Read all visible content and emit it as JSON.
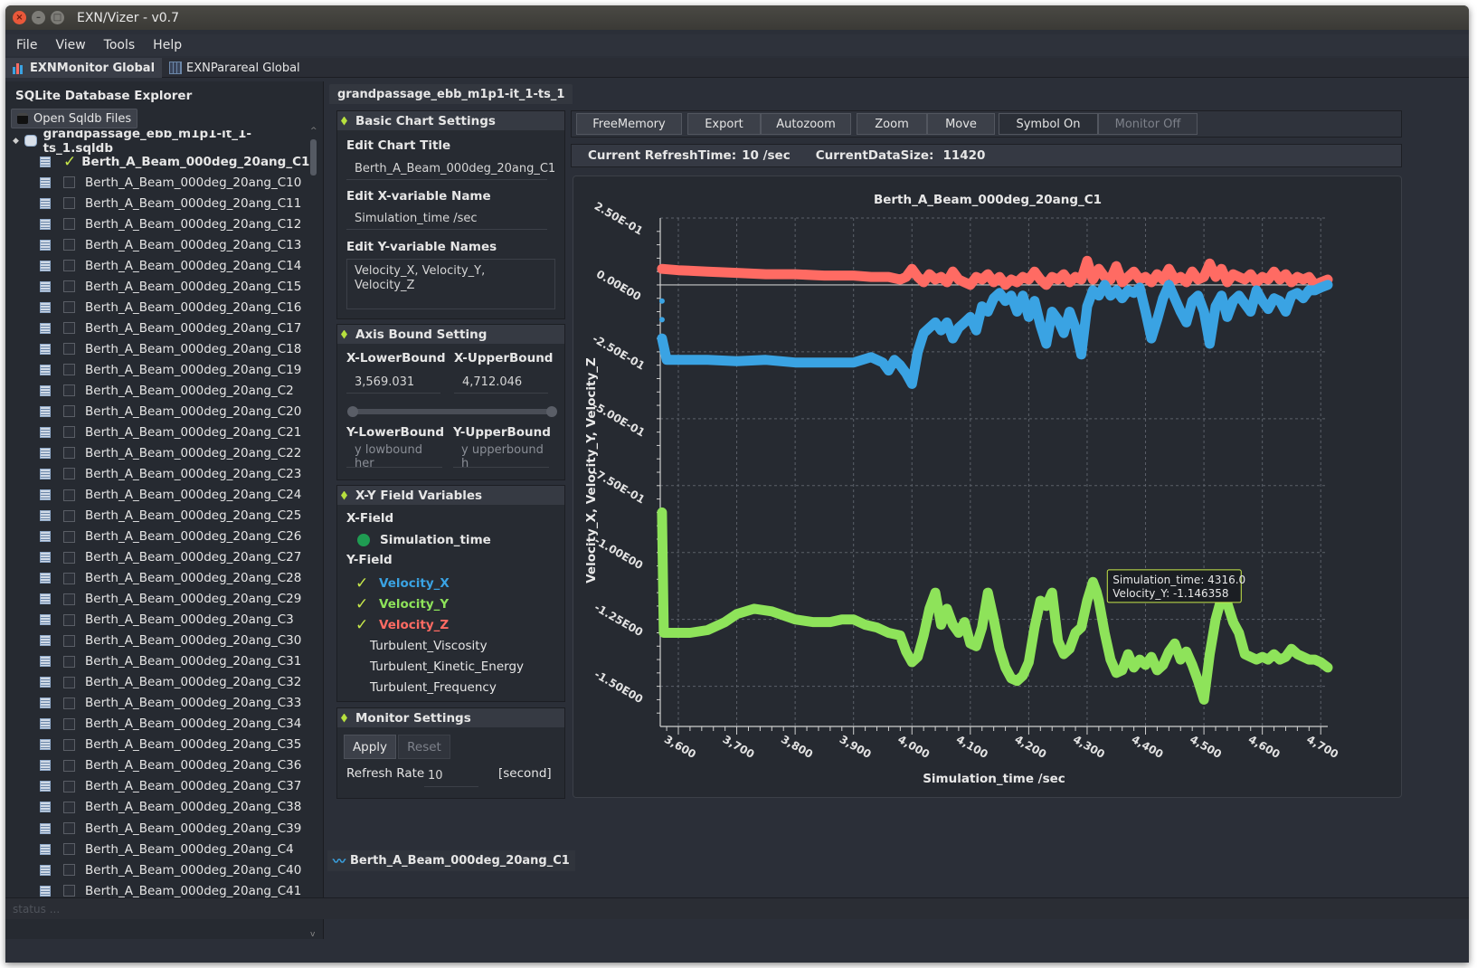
{
  "window": {
    "title": "EXN/Vizer - v0.7"
  },
  "menu": [
    "File",
    "View",
    "Tools",
    "Help"
  ],
  "tabs": [
    {
      "label": "EXNMonitor Global"
    },
    {
      "label": "EXNParareal Global"
    }
  ],
  "explorer": {
    "title": "SQLite Database Explorer",
    "open_button": "Open Sqldb Files",
    "root": "grandpassage_ebb_m1p1-it_1-ts_1.sqldb",
    "items": [
      {
        "label": "Berth_A_Beam_000deg_20ang_C1",
        "checked": true
      },
      {
        "label": "Berth_A_Beam_000deg_20ang_C10"
      },
      {
        "label": "Berth_A_Beam_000deg_20ang_C11"
      },
      {
        "label": "Berth_A_Beam_000deg_20ang_C12"
      },
      {
        "label": "Berth_A_Beam_000deg_20ang_C13"
      },
      {
        "label": "Berth_A_Beam_000deg_20ang_C14"
      },
      {
        "label": "Berth_A_Beam_000deg_20ang_C15"
      },
      {
        "label": "Berth_A_Beam_000deg_20ang_C16"
      },
      {
        "label": "Berth_A_Beam_000deg_20ang_C17"
      },
      {
        "label": "Berth_A_Beam_000deg_20ang_C18"
      },
      {
        "label": "Berth_A_Beam_000deg_20ang_C19"
      },
      {
        "label": "Berth_A_Beam_000deg_20ang_C2"
      },
      {
        "label": "Berth_A_Beam_000deg_20ang_C20"
      },
      {
        "label": "Berth_A_Beam_000deg_20ang_C21"
      },
      {
        "label": "Berth_A_Beam_000deg_20ang_C22"
      },
      {
        "label": "Berth_A_Beam_000deg_20ang_C23"
      },
      {
        "label": "Berth_A_Beam_000deg_20ang_C24"
      },
      {
        "label": "Berth_A_Beam_000deg_20ang_C25"
      },
      {
        "label": "Berth_A_Beam_000deg_20ang_C26"
      },
      {
        "label": "Berth_A_Beam_000deg_20ang_C27"
      },
      {
        "label": "Berth_A_Beam_000deg_20ang_C28"
      },
      {
        "label": "Berth_A_Beam_000deg_20ang_C29"
      },
      {
        "label": "Berth_A_Beam_000deg_20ang_C3"
      },
      {
        "label": "Berth_A_Beam_000deg_20ang_C30"
      },
      {
        "label": "Berth_A_Beam_000deg_20ang_C31"
      },
      {
        "label": "Berth_A_Beam_000deg_20ang_C32"
      },
      {
        "label": "Berth_A_Beam_000deg_20ang_C33"
      },
      {
        "label": "Berth_A_Beam_000deg_20ang_C34"
      },
      {
        "label": "Berth_A_Beam_000deg_20ang_C35"
      },
      {
        "label": "Berth_A_Beam_000deg_20ang_C36"
      },
      {
        "label": "Berth_A_Beam_000deg_20ang_C37"
      },
      {
        "label": "Berth_A_Beam_000deg_20ang_C38"
      },
      {
        "label": "Berth_A_Beam_000deg_20ang_C39"
      },
      {
        "label": "Berth_A_Beam_000deg_20ang_C4"
      },
      {
        "label": "Berth_A_Beam_000deg_20ang_C40"
      },
      {
        "label": "Berth_A_Beam_000deg_20ang_C41"
      }
    ]
  },
  "main_tab": "grandpassage_ebb_m1p1-it_1-ts_1",
  "basic": {
    "header": "Basic Chart Settings",
    "title_label": "Edit Chart Title",
    "title_value": "Berth_A_Beam_000deg_20ang_C1",
    "x_label": "Edit X-variable Name",
    "x_value": "Simulation_time /sec",
    "y_label": "Edit Y-variable Names",
    "y_value": "Velocity_X,  Velocity_Y,\nVelocity_Z"
  },
  "axis": {
    "header": "Axis Bound Setting",
    "xl_label": "X-LowerBound",
    "xu_label": "X-UpperBound",
    "xl_value": "3,569.031",
    "xu_value": "4,712.046",
    "yl_label": "Y-LowerBound",
    "yu_label": "Y-UpperBound",
    "yl_placeholder": "y lowbound her",
    "yu_placeholder": "y upperbound h"
  },
  "fields": {
    "header": "X-Y Field Variables",
    "x_label": "X-Field",
    "x_value": "Simulation_time",
    "y_label": "Y-Field",
    "y_items": [
      {
        "label": "Velocity_X",
        "checked": true,
        "color": "#3aa3e3"
      },
      {
        "label": "Velocity_Y",
        "checked": true,
        "color": "#8ee35a"
      },
      {
        "label": "Velocity_Z",
        "checked": true,
        "color": "#ff6b63"
      },
      {
        "label": "Turbulent_Viscosity",
        "checked": false
      },
      {
        "label": "Turbulent_Kinetic_Energy",
        "checked": false
      },
      {
        "label": "Turbulent_Frequency",
        "checked": false
      }
    ]
  },
  "monitor": {
    "header": "Monitor Settings",
    "apply": "Apply",
    "reset": "Reset",
    "rate_label": "Refresh Rate",
    "rate_value": "10",
    "rate_unit": "[second]"
  },
  "toolbar": {
    "freememory": "FreeMemory",
    "export": "Export",
    "autozoom": "Autozoom",
    "zoom": "Zoom",
    "move": "Move",
    "symbol": "Symbol On",
    "monitor": "Monitor Off"
  },
  "info": {
    "refresh_label": "Current RefreshTime:",
    "refresh_value": "10 /sec",
    "size_label": "CurrentDataSize:",
    "size_value": "11420"
  },
  "bottom_tab": "Berth_A_Beam_000deg_20ang_C1",
  "status": "status ...",
  "tooltip": {
    "line1": "Simulation_time: 4316.0",
    "line2": "Velocity_Y: -1.146358"
  },
  "chart_data": {
    "type": "line",
    "title": "Berth_A_Beam_000deg_20ang_C1",
    "xlabel": "Simulation_time /sec",
    "ylabel": "Velocity_X,  Velocity_Y,  Velocity_Z",
    "xlim": [
      3569.031,
      4712.046
    ],
    "ylim": [
      -1.65,
      0.25
    ],
    "xticks": [
      3600,
      3700,
      3800,
      3900,
      4000,
      4100,
      4200,
      4300,
      4400,
      4500,
      4600,
      4700
    ],
    "xtick_labels": [
      "3,600",
      "3,700",
      "3,800",
      "3,900",
      "4,000",
      "4,100",
      "4,200",
      "4,300",
      "4,400",
      "4,500",
      "4,600",
      "4,700"
    ],
    "yticks": [
      0.25,
      0,
      -0.25,
      -0.5,
      -0.75,
      -1.0,
      -1.25,
      -1.5
    ],
    "ytick_labels": [
      "2.50E-01",
      "0.00E00",
      "-2.50E-01",
      "-5.00E-01",
      "-7.50E-01",
      "-1.00E00",
      "-1.25E00",
      "-1.50E00"
    ],
    "grid": true,
    "series": [
      {
        "name": "Velocity_Z",
        "color": "#ff6b63",
        "x": [
          3572,
          3600,
          3650,
          3700,
          3750,
          3800,
          3850,
          3900,
          3930,
          3960,
          3980,
          3990,
          4000,
          4010,
          4020,
          4030,
          4040,
          4050,
          4060,
          4070,
          4080,
          4090,
          4100,
          4110,
          4120,
          4130,
          4140,
          4150,
          4160,
          4170,
          4180,
          4190,
          4200,
          4210,
          4220,
          4230,
          4240,
          4250,
          4260,
          4270,
          4280,
          4290,
          4300,
          4310,
          4320,
          4330,
          4340,
          4350,
          4360,
          4370,
          4380,
          4390,
          4400,
          4410,
          4420,
          4430,
          4440,
          4450,
          4460,
          4470,
          4480,
          4490,
          4500,
          4510,
          4520,
          4530,
          4540,
          4550,
          4560,
          4570,
          4580,
          4590,
          4600,
          4610,
          4620,
          4630,
          4640,
          4650,
          4660,
          4670,
          4680,
          4690,
          4700,
          4712
        ],
        "y": [
          0.06,
          0.055,
          0.05,
          0.045,
          0.04,
          0.04,
          0.035,
          0.035,
          0.03,
          0.03,
          0.02,
          0.03,
          0.06,
          0.03,
          0.01,
          0.04,
          0.02,
          0.03,
          0.01,
          0.05,
          0.02,
          0.01,
          0.0,
          0.03,
          0.02,
          0.04,
          0.01,
          0.03,
          0.0,
          0.02,
          0.01,
          0.03,
          0.02,
          0.05,
          0.02,
          0.0,
          0.03,
          0.02,
          0.04,
          0.01,
          0.03,
          0.02,
          0.09,
          0.02,
          0.06,
          0.03,
          0.02,
          0.07,
          0.01,
          0.03,
          0.05,
          0.02,
          0.03,
          0.01,
          0.04,
          0.02,
          0.06,
          0.02,
          0.03,
          0.01,
          0.05,
          0.02,
          0.03,
          0.08,
          0.03,
          0.06,
          0.01,
          0.04,
          0.03,
          0.02,
          0.04,
          0.01,
          0.03,
          0.02,
          0.05,
          0.02,
          0.04,
          0.01,
          0.03,
          0.02,
          0.03,
          0.0,
          0.01,
          0.02
        ]
      },
      {
        "name": "Velocity_X",
        "color": "#3aa3e3",
        "x": [
          3572,
          3580,
          3600,
          3650,
          3700,
          3750,
          3800,
          3850,
          3900,
          3930,
          3950,
          3960,
          3970,
          3980,
          3990,
          4000,
          4010,
          4020,
          4030,
          4040,
          4050,
          4060,
          4070,
          4080,
          4090,
          4100,
          4110,
          4120,
          4130,
          4140,
          4150,
          4160,
          4170,
          4180,
          4190,
          4200,
          4210,
          4220,
          4230,
          4240,
          4250,
          4260,
          4270,
          4280,
          4290,
          4300,
          4310,
          4320,
          4330,
          4340,
          4350,
          4360,
          4370,
          4380,
          4390,
          4400,
          4410,
          4420,
          4430,
          4440,
          4450,
          4460,
          4470,
          4480,
          4490,
          4500,
          4510,
          4520,
          4530,
          4540,
          4550,
          4560,
          4570,
          4580,
          4590,
          4600,
          4610,
          4620,
          4630,
          4640,
          4650,
          4660,
          4670,
          4680,
          4690,
          4700,
          4712
        ],
        "y": [
          -0.2,
          -0.28,
          -0.28,
          -0.28,
          -0.285,
          -0.28,
          -0.29,
          -0.29,
          -0.29,
          -0.27,
          -0.29,
          -0.32,
          -0.28,
          -0.3,
          -0.33,
          -0.37,
          -0.25,
          -0.18,
          -0.16,
          -0.14,
          -0.17,
          -0.14,
          -0.2,
          -0.16,
          -0.14,
          -0.12,
          -0.17,
          -0.08,
          -0.1,
          -0.05,
          -0.03,
          -0.06,
          -0.04,
          -0.1,
          -0.04,
          -0.12,
          -0.06,
          -0.15,
          -0.22,
          -0.1,
          -0.13,
          -0.18,
          -0.1,
          -0.16,
          -0.26,
          -0.08,
          -0.02,
          -0.04,
          0.0,
          -0.04,
          -0.02,
          -0.05,
          -0.02,
          -0.03,
          -0.01,
          -0.1,
          -0.2,
          -0.13,
          -0.05,
          0.0,
          -0.05,
          -0.1,
          -0.14,
          -0.06,
          -0.04,
          -0.1,
          -0.22,
          -0.08,
          -0.04,
          -0.12,
          -0.06,
          -0.04,
          -0.07,
          -0.1,
          -0.02,
          -0.06,
          -0.09,
          -0.05,
          -0.06,
          -0.1,
          -0.04,
          -0.03,
          -0.05,
          -0.02,
          -0.02,
          -0.01,
          0.0
        ]
      },
      {
        "name": "Velocity_Y",
        "color": "#8ee35a",
        "x": [
          3572,
          3575,
          3600,
          3620,
          3650,
          3680,
          3700,
          3730,
          3760,
          3800,
          3830,
          3860,
          3880,
          3900,
          3920,
          3940,
          3960,
          3980,
          3990,
          4000,
          4010,
          4020,
          4030,
          4040,
          4050,
          4060,
          4070,
          4080,
          4090,
          4100,
          4110,
          4120,
          4130,
          4140,
          4150,
          4160,
          4170,
          4180,
          4190,
          4200,
          4210,
          4220,
          4230,
          4240,
          4250,
          4260,
          4270,
          4280,
          4290,
          4300,
          4310,
          4316,
          4320,
          4330,
          4340,
          4350,
          4360,
          4370,
          4380,
          4390,
          4400,
          4410,
          4420,
          4430,
          4440,
          4450,
          4460,
          4470,
          4480,
          4490,
          4500,
          4510,
          4520,
          4530,
          4540,
          4550,
          4560,
          4570,
          4580,
          4590,
          4600,
          4610,
          4620,
          4630,
          4640,
          4650,
          4660,
          4670,
          4680,
          4690,
          4700,
          4712
        ],
        "y": [
          -0.85,
          -1.3,
          -1.3,
          -1.3,
          -1.29,
          -1.26,
          -1.23,
          -1.21,
          -1.22,
          -1.25,
          -1.26,
          -1.26,
          -1.25,
          -1.25,
          -1.27,
          -1.28,
          -1.3,
          -1.31,
          -1.37,
          -1.41,
          -1.39,
          -1.31,
          -1.21,
          -1.15,
          -1.27,
          -1.21,
          -1.27,
          -1.3,
          -1.26,
          -1.34,
          -1.35,
          -1.28,
          -1.15,
          -1.25,
          -1.36,
          -1.43,
          -1.47,
          -1.48,
          -1.46,
          -1.41,
          -1.28,
          -1.18,
          -1.2,
          -1.15,
          -1.33,
          -1.38,
          -1.36,
          -1.3,
          -1.28,
          -1.18,
          -1.11,
          -1.146,
          -1.18,
          -1.3,
          -1.4,
          -1.45,
          -1.44,
          -1.38,
          -1.43,
          -1.4,
          -1.42,
          -1.39,
          -1.44,
          -1.42,
          -1.37,
          -1.34,
          -1.4,
          -1.37,
          -1.42,
          -1.48,
          -1.55,
          -1.38,
          -1.25,
          -1.17,
          -1.19,
          -1.26,
          -1.3,
          -1.38,
          -1.39,
          -1.4,
          -1.39,
          -1.4,
          -1.38,
          -1.4,
          -1.39,
          -1.36,
          -1.38,
          -1.39,
          -1.4,
          -1.4,
          -1.41,
          -1.43
        ]
      }
    ]
  }
}
